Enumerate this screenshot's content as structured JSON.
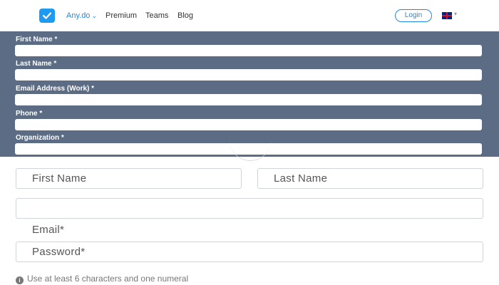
{
  "nav": {
    "brand": "Any.do",
    "brand_caret": "⌄",
    "links": [
      "Premium",
      "Teams",
      "Blog"
    ],
    "login": "Login",
    "lang_caret": "▾"
  },
  "request_form": {
    "fields": [
      {
        "label": "First Name *",
        "value": ""
      },
      {
        "label": "Last Name *",
        "value": ""
      },
      {
        "label": "Email Address (Work) *",
        "value": ""
      },
      {
        "label": "Phone *",
        "value": ""
      },
      {
        "label": "Organization *",
        "value": ""
      }
    ]
  },
  "signup": {
    "first_name_placeholder": "First Name",
    "last_name_placeholder": "Last Name",
    "email_label": "Email*",
    "password_placeholder": "Password*",
    "password_hint": "Use at least 6 characters and one numeral",
    "hint_icon": "i"
  },
  "colors": {
    "accent": "#1e88e5",
    "panel": "#5b6c84",
    "logo": "#1e9bf0"
  }
}
